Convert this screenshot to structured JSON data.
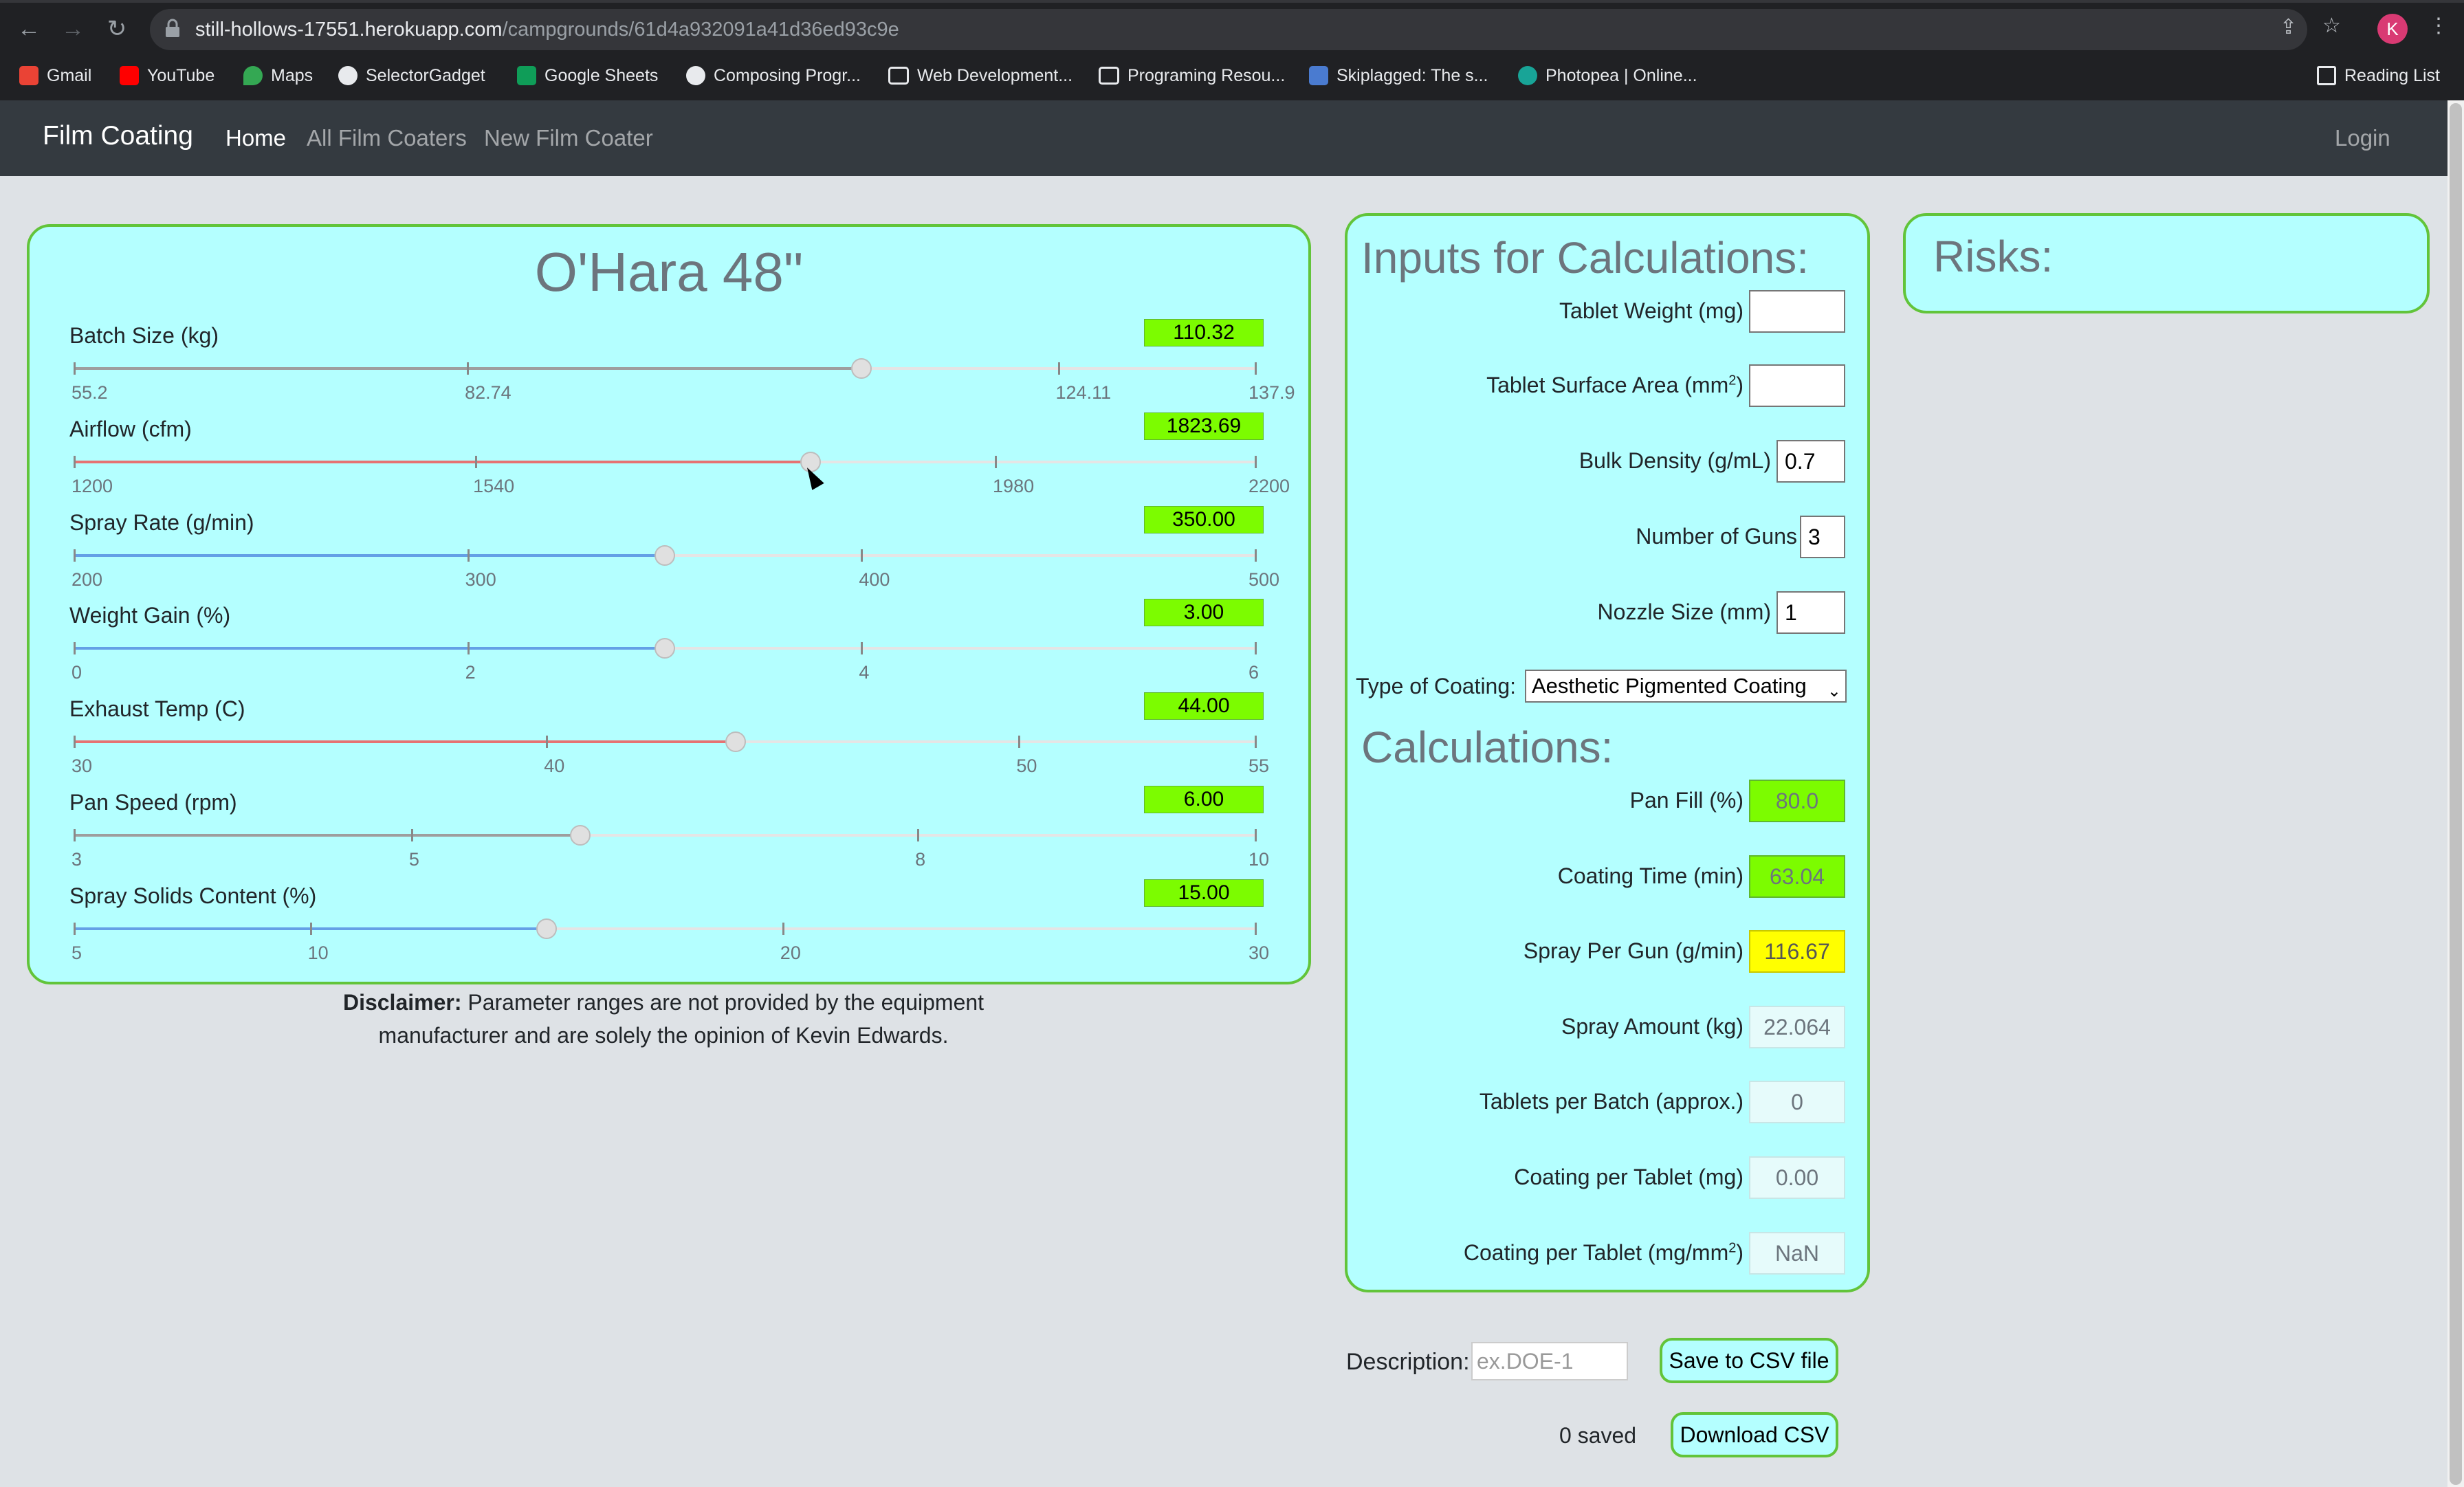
{
  "browser": {
    "url_host": "still-hollows-17551.herokuapp.com",
    "url_path": "/campgrounds/61d4a932091a41d36ed93c9e",
    "avatar_letter": "K",
    "bookmarks": [
      "Gmail",
      "YouTube",
      "Maps",
      "SelectorGadget",
      "Google Sheets",
      "Composing Progr...",
      "Web Development...",
      "Programing Resou...",
      "Skiplagged: The s...",
      "Photopea | Online..."
    ],
    "reading_list": "Reading List"
  },
  "navbar": {
    "brand": "Film Coating",
    "links": [
      "Home",
      "All Film Coaters",
      "New Film Coater"
    ],
    "login": "Login"
  },
  "machine": {
    "title": "O'Hara 48\"",
    "sliders": [
      {
        "label": "Batch Size (kg)",
        "value": "110.32",
        "min": 55.2,
        "max": 137.9,
        "current": 110.32,
        "fill_color": "#9e9e9e",
        "ticks": [
          "55.2",
          "82.74",
          "124.11",
          "137.9"
        ],
        "tick_values": [
          55.2,
          82.74,
          124.11,
          137.9
        ]
      },
      {
        "label": "Airflow (cfm)",
        "value": "1823.69",
        "min": 1200,
        "max": 2200,
        "current": 1823.69,
        "fill_color": "#e57373",
        "ticks": [
          "1200",
          "1540",
          "1980",
          "2200"
        ],
        "tick_values": [
          1200,
          1540,
          1980,
          2200
        ]
      },
      {
        "label": "Spray Rate (g/min)",
        "value": "350.00",
        "min": 200,
        "max": 500,
        "current": 350,
        "fill_color": "#64a0e6",
        "ticks": [
          "200",
          "300",
          "400",
          "500"
        ],
        "tick_values": [
          200,
          300,
          400,
          500
        ]
      },
      {
        "label": "Weight Gain (%)",
        "value": "3.00",
        "min": 0,
        "max": 6,
        "current": 3,
        "fill_color": "#64a0e6",
        "ticks": [
          "0",
          "2",
          "4",
          "6"
        ],
        "tick_values": [
          0,
          2,
          4,
          6
        ]
      },
      {
        "label": "Exhaust Temp (C)",
        "value": "44.00",
        "min": 30,
        "max": 55,
        "current": 44,
        "fill_color": "#e57373",
        "ticks": [
          "30",
          "40",
          "50",
          "55"
        ],
        "tick_values": [
          30,
          40,
          50,
          55
        ]
      },
      {
        "label": "Pan Speed (rpm)",
        "value": "6.00",
        "min": 3,
        "max": 10,
        "current": 6,
        "fill_color": "#9e9e9e",
        "ticks": [
          "3",
          "5",
          "8",
          "10"
        ],
        "tick_values": [
          3,
          5,
          8,
          10
        ]
      },
      {
        "label": "Spray Solids Content (%)",
        "value": "15.00",
        "min": 5,
        "max": 30,
        "current": 15,
        "fill_color": "#64a0e6",
        "ticks": [
          "5",
          "10",
          "20",
          "30"
        ],
        "tick_values": [
          5,
          10,
          20,
          30
        ]
      }
    ],
    "disclaimer_bold": "Disclaimer:",
    "disclaimer_text": " Parameter ranges are not provided by the equipment manufacturer and are solely the opinion of Kevin Edwards."
  },
  "inputs": {
    "title": "Inputs for Calculations:",
    "tablet_weight_label": "Tablet Weight (mg)",
    "tablet_weight_value": "",
    "surface_area_label": "Tablet Surface Area (mm",
    "surface_area_sup": "2",
    "surface_area_close": ")",
    "surface_area_value": "",
    "bulk_density_label": "Bulk Density (g/mL)",
    "bulk_density_value": "0.7",
    "guns_label": "Number of Guns",
    "guns_value": "3",
    "nozzle_label": "Nozzle Size (mm)",
    "nozzle_value": "1",
    "coating_type_label": "Type of Coating:",
    "coating_type_value": "Aesthetic Pigmented Coating"
  },
  "calculations": {
    "title": "Calculations:",
    "items": [
      {
        "label": "Pan Fill (%)",
        "value": "80.0"
      },
      {
        "label": "Coating Time (min)",
        "value": "63.04"
      },
      {
        "label": "Spray Per Gun (g/min)",
        "value": "116.67"
      },
      {
        "label": "Spray Amount (kg)",
        "value": "22.064"
      },
      {
        "label": "Tablets per Batch (approx.)",
        "value": "0"
      },
      {
        "label": "Coating per Tablet (mg)",
        "value": "0.00"
      },
      {
        "label": "Coating per Tablet (mg/mm",
        "sup": "2",
        "close": ")",
        "value": "NaN"
      }
    ]
  },
  "risks": {
    "title": "Risks:"
  },
  "actions": {
    "description_label": "Description:",
    "description_placeholder": "ex.DOE-1",
    "save_label": "Save to CSV file",
    "saved_count": "0 saved",
    "download_label": "Download CSV"
  },
  "colors": {
    "panel_bg": "#b4ffff",
    "panel_border": "#62c43a",
    "value_green": "#7cfc00",
    "value_yellow": "#ffff00",
    "navbar": "#343a40"
  }
}
